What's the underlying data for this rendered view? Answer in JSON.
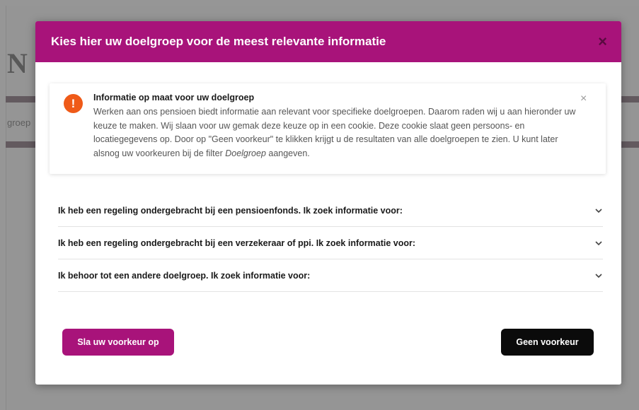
{
  "background": {
    "left_fragment_text": "groep"
  },
  "modal": {
    "title": "Kies hier uw doelgroep voor de meest relevante informatie",
    "close_glyph": "×",
    "accent_color": "#a8137a"
  },
  "alert": {
    "icon": "exclamation-icon",
    "icon_glyph": "!",
    "title": "Informatie op maat voor uw doelgroep",
    "body_part1": "Werken aan ons pensioen biedt informatie aan relevant voor specifieke doelgroepen. Daarom raden wij u aan hieronder uw keuze te maken. Wij slaan voor uw gemak deze keuze op in een cookie. Deze cookie slaat geen persoons- en locatiegegevens op. Door op \"Geen voorkeur\" te klikken krijgt u de resultaten van alle doelgroepen te zien. U kunt later alsnog uw voorkeuren bij de filter ",
    "body_emphasis": "Doelgroep",
    "body_part2": " aangeven.",
    "close_glyph": "×"
  },
  "accordion": [
    {
      "label": "Ik heb een regeling ondergebracht bij een pensioenfonds. Ik zoek informatie voor:"
    },
    {
      "label": "Ik heb een regeling ondergebracht bij een verzekeraar of ppi. Ik zoek informatie voor:"
    },
    {
      "label": "Ik behoor tot een andere doelgroep. Ik zoek informatie voor:"
    }
  ],
  "buttons": {
    "save_label": "Sla uw voorkeur op",
    "no_preference_label": "Geen voorkeur"
  }
}
